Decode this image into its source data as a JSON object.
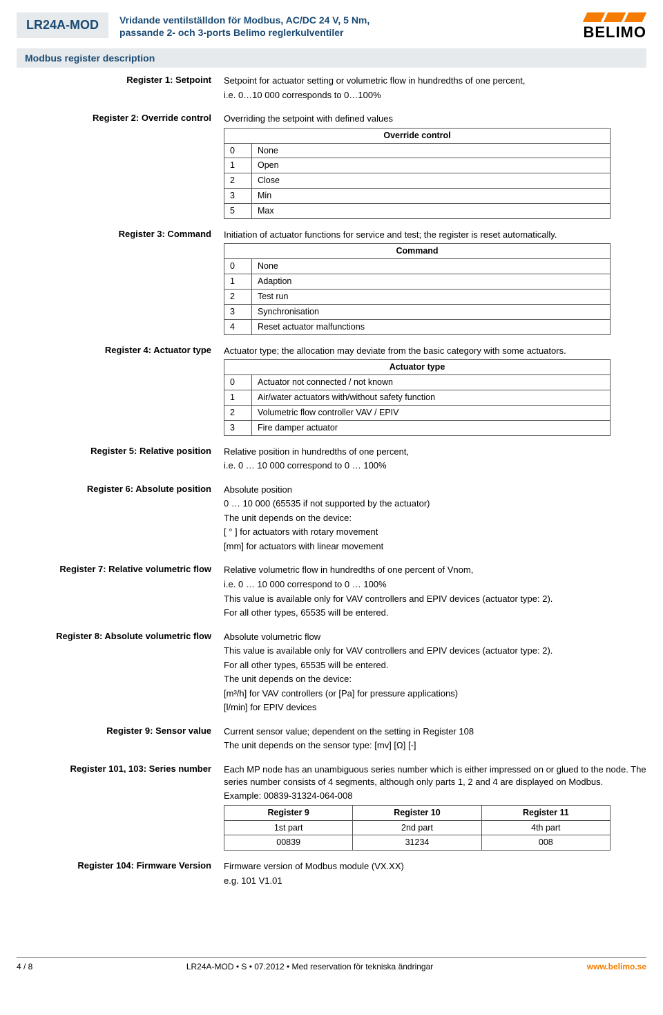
{
  "header": {
    "code": "LR24A-MOD",
    "subtitle_l1": "Vridande ventilställdon för Modbus, AC/DC 24 V, 5 Nm,",
    "subtitle_l2": "passande 2- och 3-ports Belimo reglerkulventiler",
    "logo_text": "BELIMO"
  },
  "section_title": "Modbus register description",
  "reg1": {
    "label": "Register 1: Setpoint",
    "p1": "Setpoint for actuator setting or volumetric flow in hundredths of one percent,",
    "p2": "i.e. 0…10 000 corresponds to 0…100%"
  },
  "reg2": {
    "label": "Register 2: Override control",
    "intro": "Overriding the setpoint with defined values",
    "tbl_title": "Override control",
    "r0k": "0",
    "r0v": "None",
    "r1k": "1",
    "r1v": "Open",
    "r2k": "2",
    "r2v": "Close",
    "r3k": "3",
    "r3v": "Min",
    "r4k": "5",
    "r4v": "Max"
  },
  "reg3": {
    "label": "Register 3: Command",
    "intro": "Initiation of actuator functions for service and test; the register is reset automatically.",
    "tbl_title": "Command",
    "r0k": "0",
    "r0v": "None",
    "r1k": "1",
    "r1v": "Adaption",
    "r2k": "2",
    "r2v": "Test run",
    "r3k": "3",
    "r3v": "Synchronisation",
    "r4k": "4",
    "r4v": "Reset actuator malfunctions"
  },
  "reg4": {
    "label": "Register 4: Actuator type",
    "intro": "Actuator type; the allocation may deviate from the basic category with some actuators.",
    "tbl_title": "Actuator type",
    "r0k": "0",
    "r0v": "Actuator not connected / not known",
    "r1k": "1",
    "r1v": "Air/water actuators with/without safety function",
    "r2k": "2",
    "r2v": "Volumetric flow controller VAV / EPIV",
    "r3k": "3",
    "r3v": "Fire damper actuator"
  },
  "reg5": {
    "label": "Register 5: Relative position",
    "p1": "Relative position in hundredths of one percent,",
    "p2": "i.e. 0 … 10 000 correspond to 0 … 100%"
  },
  "reg6": {
    "label": "Register 6: Absolute position",
    "p1": "Absolute position",
    "p2": "0 … 10 000 (65535 if not supported by the actuator)",
    "p3": "The unit depends on the device:",
    "p4": "[ ° ] for actuators with rotary movement",
    "p5": "[mm] for actuators with linear movement"
  },
  "reg7": {
    "label": "Register 7: Relative volumetric flow",
    "p1": "Relative volumetric flow in hundredths of one percent of Vnom,",
    "p2": "i.e. 0 … 10 000 correspond to 0 … 100%",
    "p3": "This value is available only for VAV controllers and EPIV devices (actuator type: 2).",
    "p4": "For all other types, 65535 will be entered."
  },
  "reg8": {
    "label": "Register 8: Absolute volumetric flow",
    "p1": "Absolute volumetric flow",
    "p2": "This value is available only for VAV controllers and EPIV devices (actuator type: 2).",
    "p3": "For all other types, 65535 will be entered.",
    "p4": "The unit depends on the device:",
    "p5": "[m³/h] for VAV controllers (or [Pa] for pressure applications)",
    "p6": "[l/min] for EPIV devices"
  },
  "reg9": {
    "label": "Register 9: Sensor value",
    "p1": "Current sensor value; dependent on the setting in Register 108",
    "p2": "The unit depends on the sensor type: [mv] [Ω] [-]"
  },
  "reg101": {
    "label": "Register 101, 103: Series number",
    "p1": "Each MP node has an unambiguous series number which is either impressed on or glued to the node. The series number consists of 4 segments, although only parts 1, 2 and 4 are displayed on Modbus.",
    "p2": "Example: 00839-31324-064-008",
    "h1": "Register 9",
    "h2": "Register 10",
    "h3": "Register 11",
    "r1c1": "1st part",
    "r1c2": "2nd part",
    "r1c3": "4th part",
    "r2c1": "00839",
    "r2c2": "31234",
    "r2c3": "008"
  },
  "reg104": {
    "label": "Register 104: Firmware Version",
    "p1": "Firmware version of Modbus module (VX.XX)",
    "p2": "e.g. 101   V1.01"
  },
  "footer": {
    "left": "4 / 8",
    "center": "LR24A-MOD • S • 07.2012 • Med reservation för tekniska ändringar",
    "right": "www.belimo.se"
  }
}
